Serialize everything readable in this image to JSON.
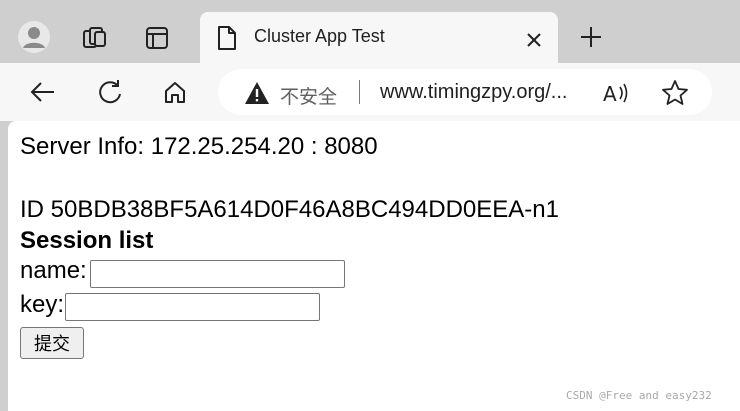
{
  "browser": {
    "tab": {
      "title": "Cluster App Test"
    },
    "addressbar": {
      "security_label": "不安全",
      "url": "www.timingzpy.org/..."
    },
    "icons": {
      "profile": "avatar-icon",
      "collections": "collections-icon",
      "tab_actions": "tab-actions-icon",
      "tab_favicon": "page-icon",
      "tab_close": "close-icon",
      "new_tab": "plus-icon",
      "back": "back-arrow-icon",
      "refresh": "refresh-icon",
      "home": "home-icon",
      "warning": "warning-icon",
      "read_aloud": "read-aloud-icon",
      "favorite": "star-icon"
    },
    "colors": {
      "chrome": "#cfcfcf",
      "toolbar": "#f7f7f7",
      "page": "#ffffff"
    }
  },
  "page": {
    "server_info": "Server Info: 172.25.254.20 : 8080",
    "session_id": "ID 50BDB38BF5A614D0F46A8BC494DD0EEA-n1",
    "session_list_heading": "Session list",
    "form": {
      "name_label": "name:",
      "name_value": "",
      "key_label": "key:",
      "key_value": "",
      "submit_label": "提交"
    },
    "watermark": "CSDN @Free and easy232"
  }
}
